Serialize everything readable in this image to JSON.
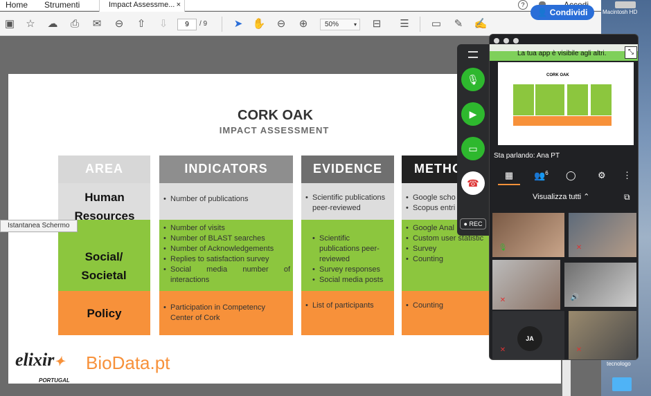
{
  "menu": {
    "home": "Home",
    "tools": "Strumenti",
    "tab_title": "Impact Assessme...",
    "tab_close": "×",
    "help": "?",
    "login": "Accedi"
  },
  "toolbar": {
    "page_current": "9",
    "page_total": "/ 9",
    "zoom": "50%",
    "share": "Condividi"
  },
  "desktop": {
    "disk": "Macintosh HD",
    "folder": "tecnologo"
  },
  "tooltip": "Istantanea Schermo",
  "slide": {
    "title": "CORK OAK",
    "subtitle": "IMPACT ASSESSMENT",
    "headers": [
      "AREA",
      "INDICATORS",
      "EVIDENCE",
      "METHO"
    ],
    "areas": [
      "Human Resources",
      "Social/ Societal",
      "Policy"
    ],
    "indicators": [
      [
        "Number of publications"
      ],
      [
        "Number of visits",
        "Number of BLAST searches",
        "Number of Acknowledgements",
        "Replies to satisfaction survey",
        "Social media number of interactions"
      ],
      [
        "Participation in Competency Center of Cork"
      ]
    ],
    "evidence": [
      [
        "Scientific publications peer-reviewed"
      ],
      [
        "Scientific publications peer-reviewed",
        "Survey responses",
        "Social media posts"
      ],
      [
        "List of participants"
      ]
    ],
    "methods": [
      [
        "Google scho",
        "Scopus entri"
      ],
      [
        "Google Anal",
        "Custom user statistic",
        "Survey",
        "Counting"
      ],
      [
        "Counting"
      ]
    ],
    "logo_left": "elixir",
    "logo_left_sub": "PORTUGAL",
    "logo_right": "BioData.pt"
  },
  "meet": {
    "visible_msg": "La tua app è visibile agli altri.",
    "speaking": "Sta parlando: Ana PT",
    "people_count": "6",
    "view_all": "Visualizza tutti",
    "ja": "JA",
    "rec": "REC"
  }
}
